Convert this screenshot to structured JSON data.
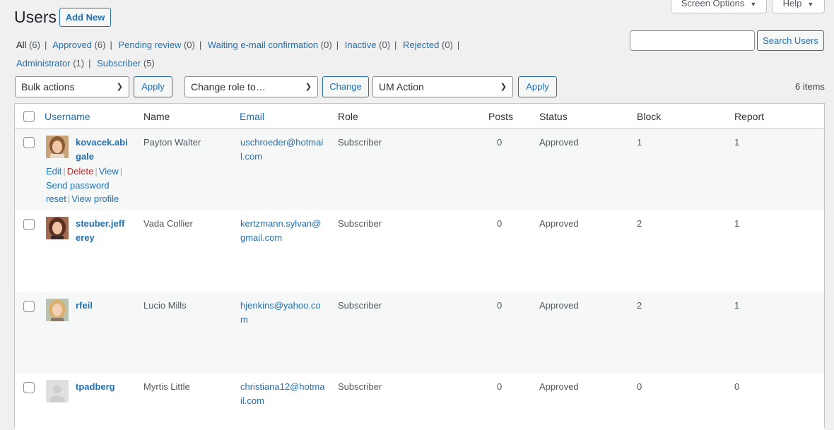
{
  "header": {
    "title": "Users",
    "add_new": "Add New",
    "screen_options": "Screen Options",
    "help": "Help"
  },
  "views": [
    {
      "label": "All",
      "count": "(6)"
    },
    {
      "label": "Approved",
      "count": "(6)"
    },
    {
      "label": "Pending review",
      "count": "(0)"
    },
    {
      "label": "Waiting e-mail confirmation",
      "count": "(0)"
    },
    {
      "label": "Inactive",
      "count": "(0)"
    },
    {
      "label": "Rejected",
      "count": "(0)"
    }
  ],
  "role_views": [
    {
      "label": "Administrator",
      "count": "(1)"
    },
    {
      "label": "Subscriber",
      "count": "(5)"
    }
  ],
  "separator": "|",
  "search": {
    "button": "Search Users",
    "value": ""
  },
  "tablenav": {
    "bulk_actions": "Bulk actions",
    "apply": "Apply",
    "change_role": "Change role to…",
    "change": "Change",
    "um_action": "UM Action",
    "apply2": "Apply",
    "items": "6 items"
  },
  "columns": {
    "username": "Username",
    "name": "Name",
    "email": "Email",
    "role": "Role",
    "posts": "Posts",
    "status": "Status",
    "block": "Block",
    "report": "Report"
  },
  "row_actions": {
    "edit": "Edit",
    "delete": "Delete",
    "view": "View",
    "send_password": "Send password",
    "reset": "reset",
    "view_profile": "View profile"
  },
  "users": [
    {
      "username": "kovacek.abigale",
      "name": "Payton Walter",
      "email": "uschroeder@hotmail.com",
      "role": "Subscriber",
      "posts": "0",
      "status": "Approved",
      "block": "1",
      "report": "1",
      "avatar": "photo-female-1"
    },
    {
      "username": "steuber.jefferey",
      "name": "Vada Collier",
      "email": "kertzmann.sylvan@gmail.com",
      "role": "Subscriber",
      "posts": "0",
      "status": "Approved",
      "block": "2",
      "report": "1",
      "avatar": "photo-female-2"
    },
    {
      "username": "rfeil",
      "name": "Lucio Mills",
      "email": "hjenkins@yahoo.com",
      "role": "Subscriber",
      "posts": "0",
      "status": "Approved",
      "block": "2",
      "report": "1",
      "avatar": "photo-female-3"
    },
    {
      "username": "tpadberg",
      "name": "Myrtis Little",
      "email": "christiana12@hotmail.com",
      "role": "Subscriber",
      "posts": "0",
      "status": "Approved",
      "block": "0",
      "report": "0",
      "avatar": "default-avatar-icon"
    }
  ]
}
